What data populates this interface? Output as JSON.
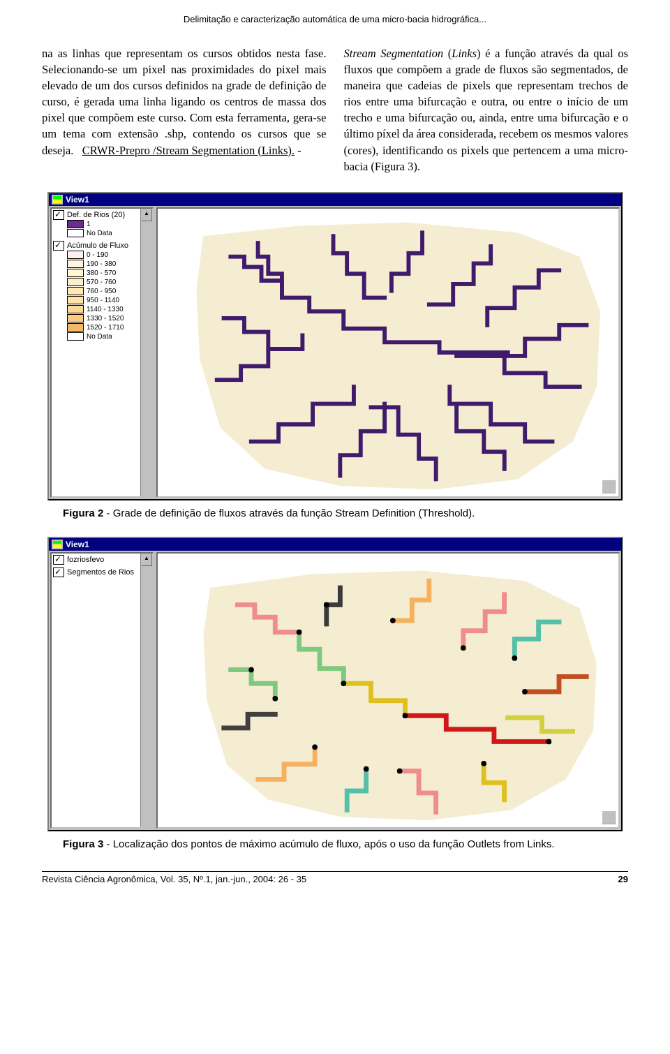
{
  "running_header": "Delimitação e caracterização automática de uma micro-bacia hidrográfica...",
  "cols": {
    "left": {
      "p1": "na as linhas que representam os cursos obtidos nesta fase. Selecionando-se um pixel nas proximidades do pixel mais elevado de um dos cursos definidos na grade de definição de curso, é gerada uma linha ligando os centros de massa dos pixel que compõem este curso. Com esta ferramenta, gera-se um tema com extensão .shp, contendo os cursos que se deseja.",
      "p2_prefix": "CRWR-Prepro /Stream Segmentation (Links).",
      "p2_suffix": " -"
    },
    "right": {
      "p1_prefix": "Stream Segmentation",
      "p1_mid": " (",
      "p1_links": "Links",
      "p1_body": ") é a função através da qual os fluxos que compõem a grade de fluxos são segmentados, de maneira que cadeias de pixels que representam trechos de rios entre uma bifurcação e outra, ou entre o início de um trecho e uma bifurcação ou, ainda, entre uma bifurcação e o último píxel da área considerada, recebem os mesmos valores (cores), identificando os pixels que pertencem a uma micro-bacia (Figura 3)."
    }
  },
  "view1": {
    "title": "View1",
    "legend": {
      "group1": {
        "title": "Def. de Rios (20)",
        "items": [
          {
            "label": "1",
            "color": "#6b2c8f"
          },
          {
            "label": "No Data",
            "color": "#ffffff"
          }
        ]
      },
      "group2": {
        "title": "Acúmulo de Fluxo",
        "items": [
          {
            "label": "0 - 190",
            "color": "#fff0f0"
          },
          {
            "label": "190 - 380",
            "color": "#fff4e0"
          },
          {
            "label": "380 - 570",
            "color": "#fff8d0"
          },
          {
            "label": "570 - 760",
            "color": "#ffefc8"
          },
          {
            "label": "760 - 950",
            "color": "#ffe9b8"
          },
          {
            "label": "950 - 1140",
            "color": "#ffe3a8"
          },
          {
            "label": "1140 - 1330",
            "color": "#ffd898"
          },
          {
            "label": "1330 - 1520",
            "color": "#ffca80"
          },
          {
            "label": "1520 - 1710",
            "color": "#f5b868"
          },
          {
            "label": "No Data",
            "color": "#ffffff"
          }
        ]
      }
    }
  },
  "fig2_caption_bold": "Figura 2",
  "fig2_caption_rest": " - Grade de definição de fluxos através da função Stream Definition (Threshold).",
  "view2": {
    "title": "View1",
    "legend": {
      "group1": {
        "title": "fozriosfevo"
      },
      "group2": {
        "title": "Segmentos de Rios"
      }
    }
  },
  "fig3_caption_bold": "Figura 3",
  "fig3_caption_rest": " - Localização dos pontos de máximo acúmulo de fluxo, após o uso da função Outlets from Links.",
  "footer": {
    "rev": "Revista Ciência Agronômica, Vol. 35, Nº.1, jan.-jun., 2004: 26 - 35",
    "page": "29"
  }
}
